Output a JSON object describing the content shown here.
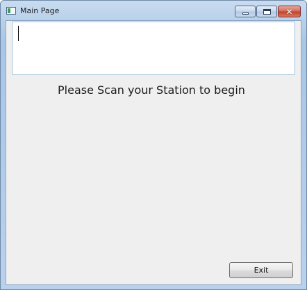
{
  "window": {
    "title": "Main Page"
  },
  "titlebar_controls": {
    "minimize": "minimize-icon",
    "maximize": "maximize-icon",
    "close": "close-icon"
  },
  "main": {
    "scan_input_value": "",
    "prompt_text": "Please Scan your Station to begin",
    "exit_label": "Exit"
  },
  "colors": {
    "frame": "#b8d0ea",
    "client_bg": "#efefef",
    "close_button": "#c0402c"
  }
}
